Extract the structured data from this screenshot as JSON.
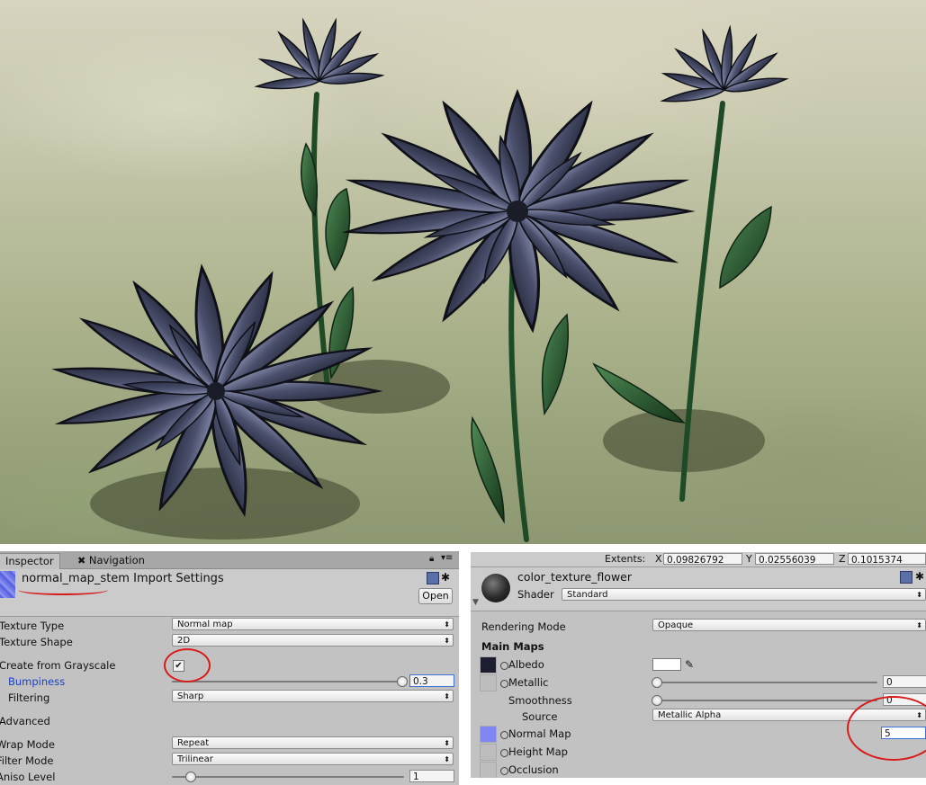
{
  "inspector": {
    "tabs": [
      {
        "label": "Inspector"
      },
      {
        "label": "Navigation"
      }
    ],
    "asset_name": "normal_map_stem",
    "title_suffix": "Import Settings",
    "open_label": "Open",
    "texture_type": {
      "label": "Texture Type",
      "value": "Normal map"
    },
    "texture_shape": {
      "label": "Texture Shape",
      "value": "2D"
    },
    "create_from_grayscale": {
      "label": "Create from Grayscale",
      "checked": true
    },
    "bumpiness": {
      "label": "Bumpiness",
      "value": "0.3"
    },
    "filtering": {
      "label": "Filtering",
      "value": "Sharp"
    },
    "advanced_label": "Advanced",
    "wrap_mode": {
      "label": "Wrap Mode",
      "value": "Repeat"
    },
    "filter_mode": {
      "label": "Filter Mode",
      "value": "Trilinear"
    },
    "aniso_level": {
      "label": "Aniso Level",
      "value": "1"
    }
  },
  "material": {
    "extents": {
      "label": "Extents:",
      "x_label": "X",
      "x": "0.09826792",
      "y_label": "Y",
      "y": "0.02556039",
      "z_label": "Z",
      "z": "0.1015374"
    },
    "name": "color_texture_flower",
    "shader_label": "Shader",
    "shader_value": "Standard",
    "rendering_mode": {
      "label": "Rendering Mode",
      "value": "Opaque"
    },
    "main_maps_label": "Main Maps",
    "albedo_label": "Albedo",
    "metallic": {
      "label": "Metallic",
      "value": "0"
    },
    "smoothness": {
      "label": "Smoothness",
      "value": "0"
    },
    "source": {
      "label": "Source",
      "value": "Metallic Alpha"
    },
    "normal_map": {
      "label": "Normal Map",
      "value": "5"
    },
    "height_map_label": "Height Map",
    "occlusion_label": "Occlusion"
  },
  "colors": {
    "annotation": "#d81b1b",
    "petal": "#3b3f58",
    "stem": "#1f4a26",
    "blue_label": "#1a3fc9",
    "focus_outline": "#3d6fd6"
  }
}
